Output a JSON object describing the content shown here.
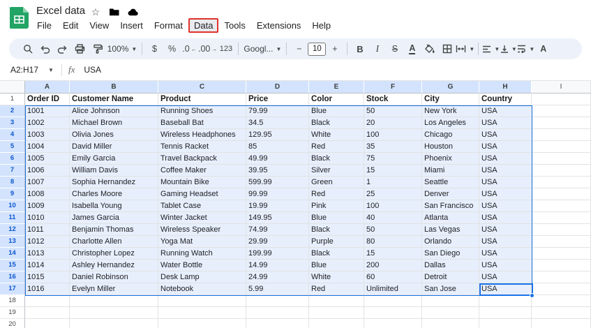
{
  "app": {
    "title": "Excel data",
    "menus": [
      "File",
      "Edit",
      "View",
      "Insert",
      "Format",
      "Data",
      "Tools",
      "Extensions",
      "Help"
    ],
    "highlighted_menu": "Data",
    "annotation_color": "#e0312d",
    "logo_color": "#21a464"
  },
  "toolbar": {
    "zoom_value": "100%",
    "currency": "$",
    "percent": "%",
    "decrease_decimal": ".0",
    "increase_decimal": ".00",
    "more_formats": "123",
    "font_family_value": "Googl...",
    "decrease_font": "−",
    "font_size_value": "10",
    "increase_font": "+",
    "bold": "B",
    "italic": "I",
    "strikethrough": "S",
    "text_color": "A",
    "text_rotation": "A"
  },
  "formula_bar": {
    "name_box_value": "A2:H17",
    "fx_label": "fx",
    "input_value": "USA"
  },
  "sheet": {
    "column_letters": [
      "A",
      "B",
      "C",
      "D",
      "E",
      "F",
      "G",
      "H",
      "I"
    ],
    "selected_columns": [
      "A",
      "B",
      "C",
      "D",
      "E",
      "F",
      "G",
      "H"
    ],
    "visible_row_count": 20,
    "header_row": [
      "Order ID",
      "Customer Name",
      "Product",
      "Price",
      "Color",
      "Stock",
      "City",
      "Country"
    ],
    "rows": [
      [
        "1001",
        "Alice Johnson",
        "Running Shoes",
        "79.99",
        "Blue",
        "50",
        "New York",
        "USA"
      ],
      [
        "1002",
        "Michael Brown",
        "Baseball Bat",
        "34.5",
        "Black",
        "20",
        "Los Angeles",
        "USA"
      ],
      [
        "1003",
        "Olivia Jones",
        "Wireless Headphones",
        "129.95",
        "White",
        "100",
        "Chicago",
        "USA"
      ],
      [
        "1004",
        "David Miller",
        "Tennis Racket",
        "85",
        "Red",
        "35",
        "Houston",
        "USA"
      ],
      [
        "1005",
        "Emily Garcia",
        "Travel Backpack",
        "49.99",
        "Black",
        "75",
        "Phoenix",
        "USA"
      ],
      [
        "1006",
        "William Davis",
        "Coffee Maker",
        "39.95",
        "Silver",
        "15",
        "Miami",
        "USA"
      ],
      [
        "1007",
        "Sophia Hernandez",
        "Mountain Bike",
        "599.99",
        "Green",
        "1",
        "Seattle",
        "USA"
      ],
      [
        "1008",
        "Charles Moore",
        "Gaming Headset",
        "99.99",
        "Red",
        "25",
        "Denver",
        "USA"
      ],
      [
        "1009",
        "Isabella Young",
        "Tablet Case",
        "19.99",
        "Pink",
        "100",
        "San Francisco",
        "USA"
      ],
      [
        "1010",
        "James Garcia",
        "Winter Jacket",
        "149.95",
        "Blue",
        "40",
        "Atlanta",
        "USA"
      ],
      [
        "1011",
        "Benjamin Thomas",
        "Wireless Speaker",
        "74.99",
        "Black",
        "50",
        "Las Vegas",
        "USA"
      ],
      [
        "1012",
        "Charlotte Allen",
        "Yoga Mat",
        "29.99",
        "Purple",
        "80",
        "Orlando",
        "USA"
      ],
      [
        "1013",
        "Christopher Lopez",
        "Running Watch",
        "199.99",
        "Black",
        "15",
        "San Diego",
        "USA"
      ],
      [
        "1014",
        "Ashley Hernandez",
        "Water Bottle",
        "14.99",
        "Blue",
        "200",
        "Dallas",
        "USA"
      ],
      [
        "1015",
        "Daniel Robinson",
        "Desk Lamp",
        "24.99",
        "White",
        "60",
        "Detroit",
        "USA"
      ],
      [
        "1016",
        "Evelyn Miller",
        "Notebook",
        "5.99",
        "Red",
        "Unlimited",
        "San Jose",
        "USA"
      ]
    ],
    "selection": {
      "range": "A2:H17",
      "active_cell": "H17"
    },
    "colors": {
      "selection_border": "#1a73e8",
      "selection_fill": "#e7effd",
      "selected_header_fill": "#d3e3fd"
    }
  }
}
